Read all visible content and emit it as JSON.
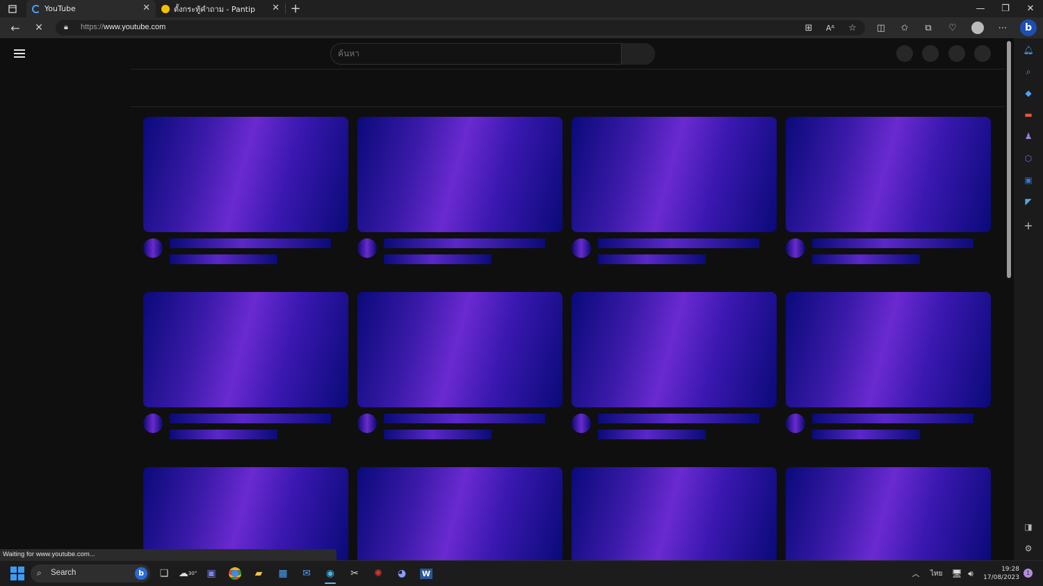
{
  "tabs": [
    {
      "title": "YouTube",
      "active": true
    },
    {
      "title": "ตั้งกระทู้คำถาม - Pantip",
      "active": false
    }
  ],
  "address": {
    "scheme": "https://",
    "host": "www.youtube.com"
  },
  "youtube": {
    "search_placeholder": "ค้นหา"
  },
  "status_text": "Waiting for www.youtube.com...",
  "taskbar": {
    "search_label": "Search",
    "weather_temp": "30°",
    "language": "ไทย",
    "time": "19:28",
    "date": "17/08/2023"
  },
  "colors": {
    "thumb_mid": "#6a2ad0",
    "thumb_edge": "#0a0a7a",
    "page_bg": "#0f0f0f"
  }
}
